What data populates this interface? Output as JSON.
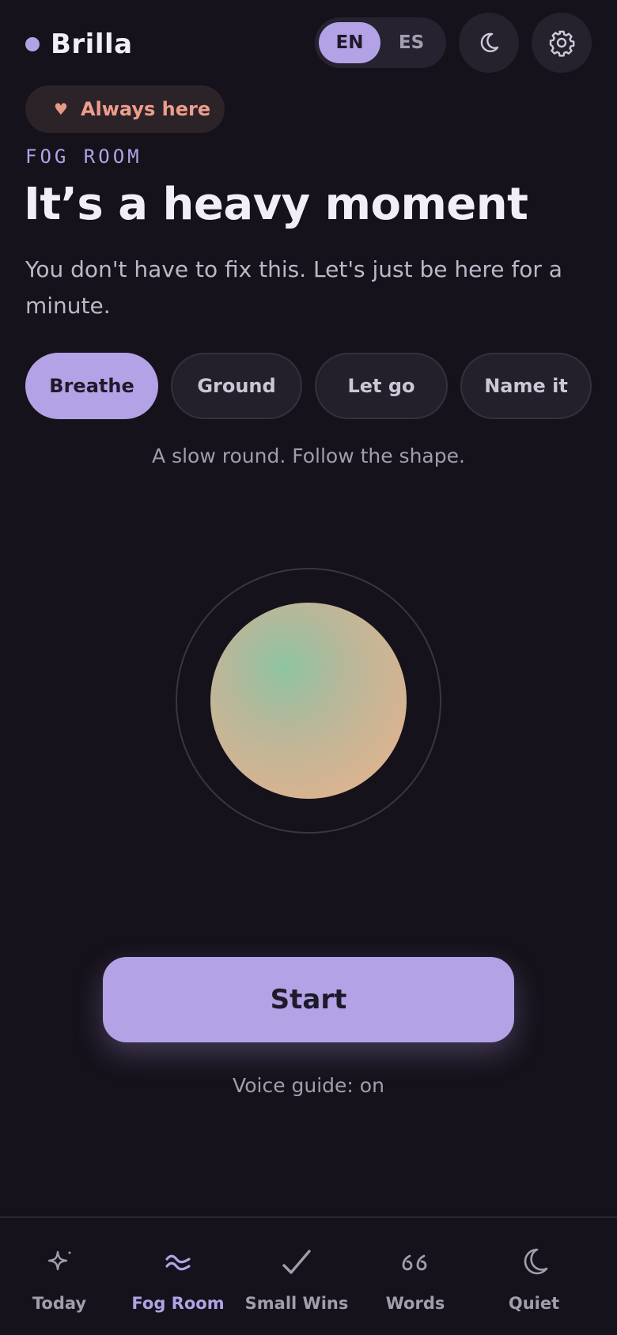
{
  "brand": {
    "name": "Brilla",
    "accent": "#b3a2e6"
  },
  "header": {
    "languages": [
      {
        "label": "EN",
        "selected": true
      },
      {
        "label": "ES",
        "selected": false
      }
    ],
    "theme_icon": "moon-icon",
    "settings_icon": "gear-icon"
  },
  "badge": {
    "label": "Always here",
    "icon": "heart-icon"
  },
  "eyebrow": "FOG ROOM",
  "title": "It’s a heavy moment",
  "subtitle": "You don't have to fix this. Let's just be here for a minute.",
  "modes": [
    {
      "label": "Breathe",
      "selected": true
    },
    {
      "label": "Ground",
      "selected": false
    },
    {
      "label": "Let go",
      "selected": false
    },
    {
      "label": "Name it",
      "selected": false
    }
  ],
  "hint": "A slow round. Follow the shape.",
  "start_label": "Start",
  "voice_status": "Voice guide: on",
  "tabs": [
    {
      "label": "Today",
      "icon": "sparkle-icon",
      "active": false
    },
    {
      "label": "Fog Room",
      "icon": "waves-icon",
      "active": true
    },
    {
      "label": "Small Wins",
      "icon": "check-icon",
      "active": false
    },
    {
      "label": "Words",
      "icon": "quote-icon",
      "active": false
    },
    {
      "label": "Quiet",
      "icon": "moon-icon",
      "active": false
    }
  ]
}
